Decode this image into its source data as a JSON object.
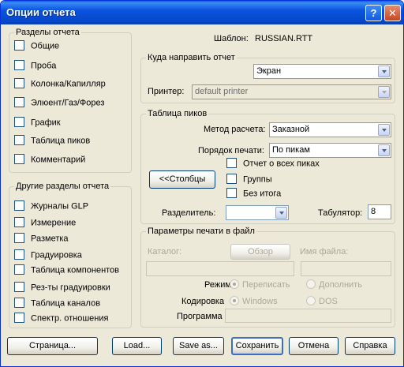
{
  "window": {
    "title": "Опции отчета",
    "help_label": "?",
    "close_label": "✕"
  },
  "sections": {
    "title": "Разделы отчета",
    "items": [
      "Общие",
      "Проба",
      "Колонка/Капилляр",
      "Элюент/Газ/Форез",
      "График",
      "Таблица пиков",
      "Комментарий"
    ]
  },
  "other_sections": {
    "title": "Другие разделы отчета",
    "items": [
      "Журналы GLP",
      "Измерение",
      "Разметка",
      "Градуировка",
      "Таблица компонентов",
      "Рез-ты градуировки",
      "Таблица каналов",
      "Спектр. отношения"
    ]
  },
  "template": {
    "label": "Шаблон:",
    "value": "RUSSIAN.RTT"
  },
  "destination": {
    "title": "Куда направить отчет",
    "target_value": "Экран",
    "printer_label": "Принтер:",
    "printer_value": "default printer"
  },
  "peaks": {
    "title": "Таблица пиков",
    "method_label": "Метод расчета:",
    "method_value": "Заказной",
    "order_label": "Порядок печати:",
    "order_value": "По пикам",
    "columns_button": "<<Столбцы",
    "checks": [
      "Отчет о всех пиках",
      "Группы",
      "Без итога"
    ],
    "separator_label": "Разделитель:",
    "separator_value": "",
    "tab_label": "Табулятор:",
    "tab_value": "8"
  },
  "file_print": {
    "title": "Параметры печати в файл",
    "catalog_label": "Каталог:",
    "browse_button": "Обзор",
    "filename_label": "Имя файла:",
    "mode_label": "Режим:",
    "mode_options": [
      "Переписать",
      "Дополнить"
    ],
    "encoding_label": "Кодировка",
    "encoding_options": [
      "Windows",
      "DOS"
    ],
    "program_label": "Программа"
  },
  "buttons": {
    "page": "Страница...",
    "load": "Load...",
    "save_as": "Save as...",
    "save": "Сохранить",
    "cancel": "Отмена",
    "help": "Справка"
  }
}
